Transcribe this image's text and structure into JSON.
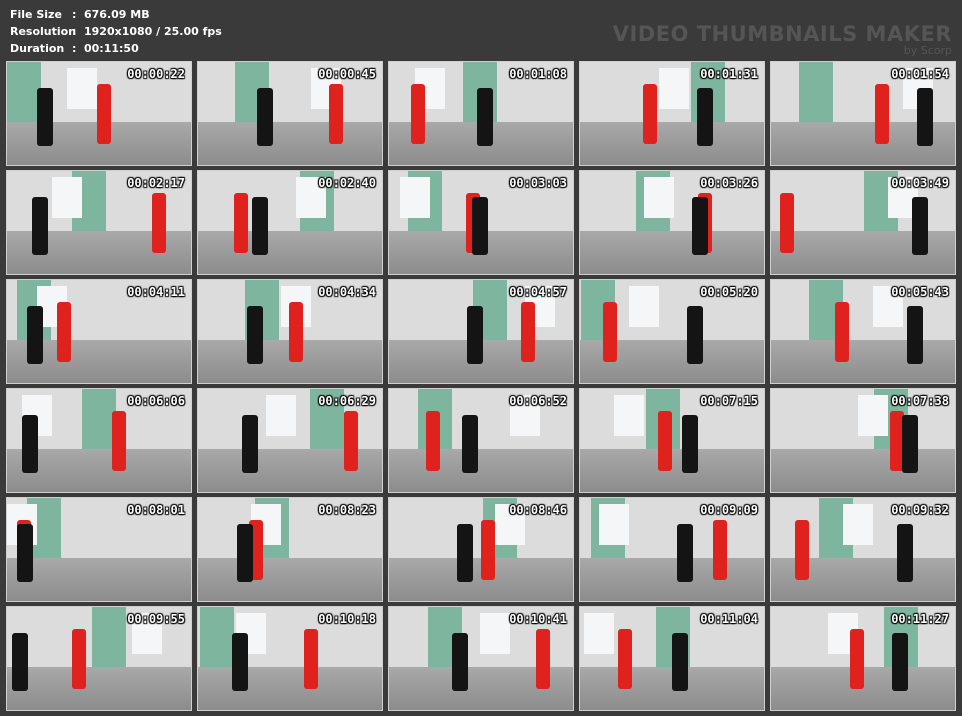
{
  "info": {
    "file_size_label": "File Size",
    "file_size": "676.09 MB",
    "resolution_label": "Resolution",
    "resolution": "1920x1080 / 25.00 fps",
    "duration_label": "Duration",
    "duration": "00:11:50",
    "separator": ":"
  },
  "brand": {
    "main": "VIDEO THUMBNAILS MAKER",
    "by": "by Scorp"
  },
  "thumbnails": [
    "00:00:22",
    "00:00:45",
    "00:01:08",
    "00:01:31",
    "00:01:54",
    "00:02:17",
    "00:02:40",
    "00:03:03",
    "00:03:26",
    "00:03:49",
    "00:04:11",
    "00:04:34",
    "00:04:57",
    "00:05:20",
    "00:05:43",
    "00:06:06",
    "00:06:29",
    "00:06:52",
    "00:07:15",
    "00:07:38",
    "00:08:01",
    "00:08:23",
    "00:08:46",
    "00:09:09",
    "00:09:32",
    "00:09:55",
    "00:10:18",
    "00:10:41",
    "00:11:04",
    "00:11:27"
  ],
  "colors": {
    "background": "#3a3a3a",
    "figure_red": "#e0221f",
    "figure_black": "#141414"
  }
}
